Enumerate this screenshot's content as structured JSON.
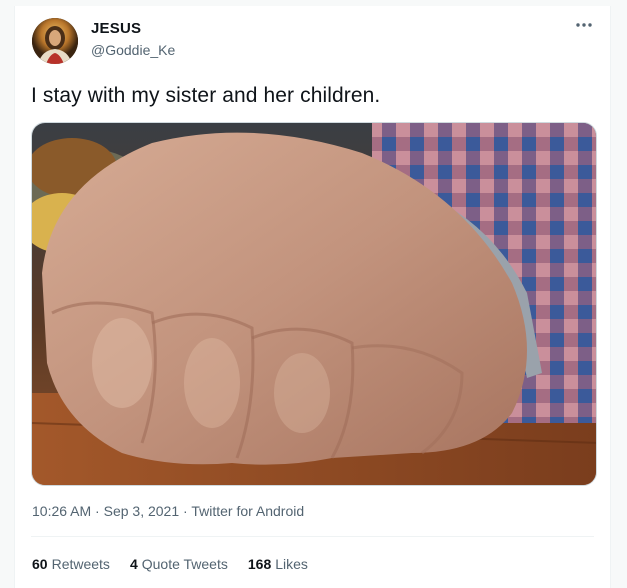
{
  "tweet": {
    "author_name": "JESUS",
    "author_handle": "@Goddie_Ke",
    "text": "I stay with my sister and her children.",
    "time": "10:26 AM",
    "separator": " · ",
    "date": "Sep 3, 2021",
    "source": "Twitter for Android",
    "stats": {
      "retweets_count": "60",
      "retweets_label": "Retweets",
      "quote_count": "4",
      "quote_label": "Quote Tweets",
      "likes_count": "168",
      "likes_label": "Likes"
    }
  },
  "icons": {
    "more": "more-options-icon"
  },
  "colors": {
    "text_primary": "#0f1419",
    "text_secondary": "#536471",
    "border": "#eff3f4"
  }
}
